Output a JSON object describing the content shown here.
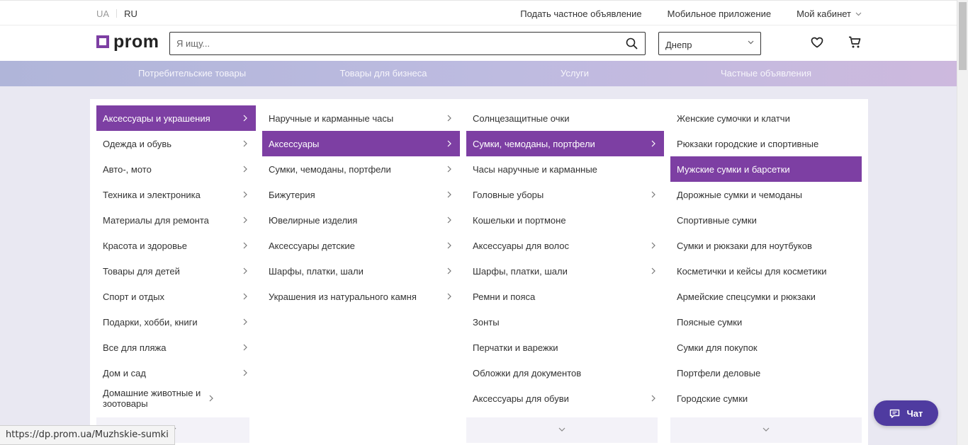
{
  "lang": {
    "ua": "UA",
    "ru": "RU"
  },
  "toplinks": {
    "post_ad": "Подать частное объявление",
    "mobile_app": "Мобильное приложение",
    "cabinet": "Мой кабинет"
  },
  "logo": {
    "text": "prom"
  },
  "search": {
    "placeholder": "Я ищу..."
  },
  "city": {
    "value": "Днепр"
  },
  "nav": {
    "tabs": [
      {
        "label": "Потребительские товары"
      },
      {
        "label": "Товары для бизнеса"
      },
      {
        "label": "Услуги"
      },
      {
        "label": "Частные объявления"
      }
    ]
  },
  "columns": {
    "col1": [
      {
        "label": "Аксессуары и украшения"
      },
      {
        "label": "Одежда и обувь"
      },
      {
        "label": "Авто-, мото"
      },
      {
        "label": "Техника и электроника"
      },
      {
        "label": "Материалы для ремонта"
      },
      {
        "label": "Красота и здоровье"
      },
      {
        "label": "Товары для детей"
      },
      {
        "label": "Спорт и отдых"
      },
      {
        "label": "Подарки, хобби, книги"
      },
      {
        "label": "Все для пляжа"
      },
      {
        "label": "Дом и сад"
      },
      {
        "label": "Домашние животные и зоотовары"
      }
    ],
    "col2": [
      {
        "label": "Наручные и карманные часы"
      },
      {
        "label": "Аксессуары"
      },
      {
        "label": "Сумки, чемоданы, портфели"
      },
      {
        "label": "Бижутерия"
      },
      {
        "label": "Ювелирные изделия"
      },
      {
        "label": "Аксессуары детские"
      },
      {
        "label": "Шарфы, платки, шали"
      },
      {
        "label": "Украшения из натурального камня"
      }
    ],
    "col3": [
      {
        "label": "Солнцезащитные очки"
      },
      {
        "label": "Сумки, чемоданы, портфели"
      },
      {
        "label": "Часы наручные и карманные"
      },
      {
        "label": "Головные уборы"
      },
      {
        "label": "Кошельки и портмоне"
      },
      {
        "label": "Аксессуары для волос"
      },
      {
        "label": "Шарфы, платки, шали"
      },
      {
        "label": "Ремни и пояса"
      },
      {
        "label": "Зонты"
      },
      {
        "label": "Перчатки и варежки"
      },
      {
        "label": "Обложки для документов"
      },
      {
        "label": "Аксессуары для обуви"
      }
    ],
    "col4": [
      {
        "label": "Женские сумочки и клатчи"
      },
      {
        "label": "Рюкзаки городские и спортивные"
      },
      {
        "label": "Мужские сумки и барсетки"
      },
      {
        "label": "Дорожные сумки и чемоданы"
      },
      {
        "label": "Спортивные сумки"
      },
      {
        "label": "Сумки и рюкзаки для ноутбуков"
      },
      {
        "label": "Косметички и кейсы для косметики"
      },
      {
        "label": "Армейские спецсумки и рюкзаки"
      },
      {
        "label": "Поясные сумки"
      },
      {
        "label": "Сумки для покупок"
      },
      {
        "label": "Портфели деловые"
      },
      {
        "label": "Городские сумки"
      }
    ]
  },
  "status_url": "https://dp.prom.ua/Muzhskie-sumki",
  "chat": {
    "label": "Чат"
  },
  "colors": {
    "accent": "#7d3fa3",
    "chat": "#4f3ba0"
  }
}
